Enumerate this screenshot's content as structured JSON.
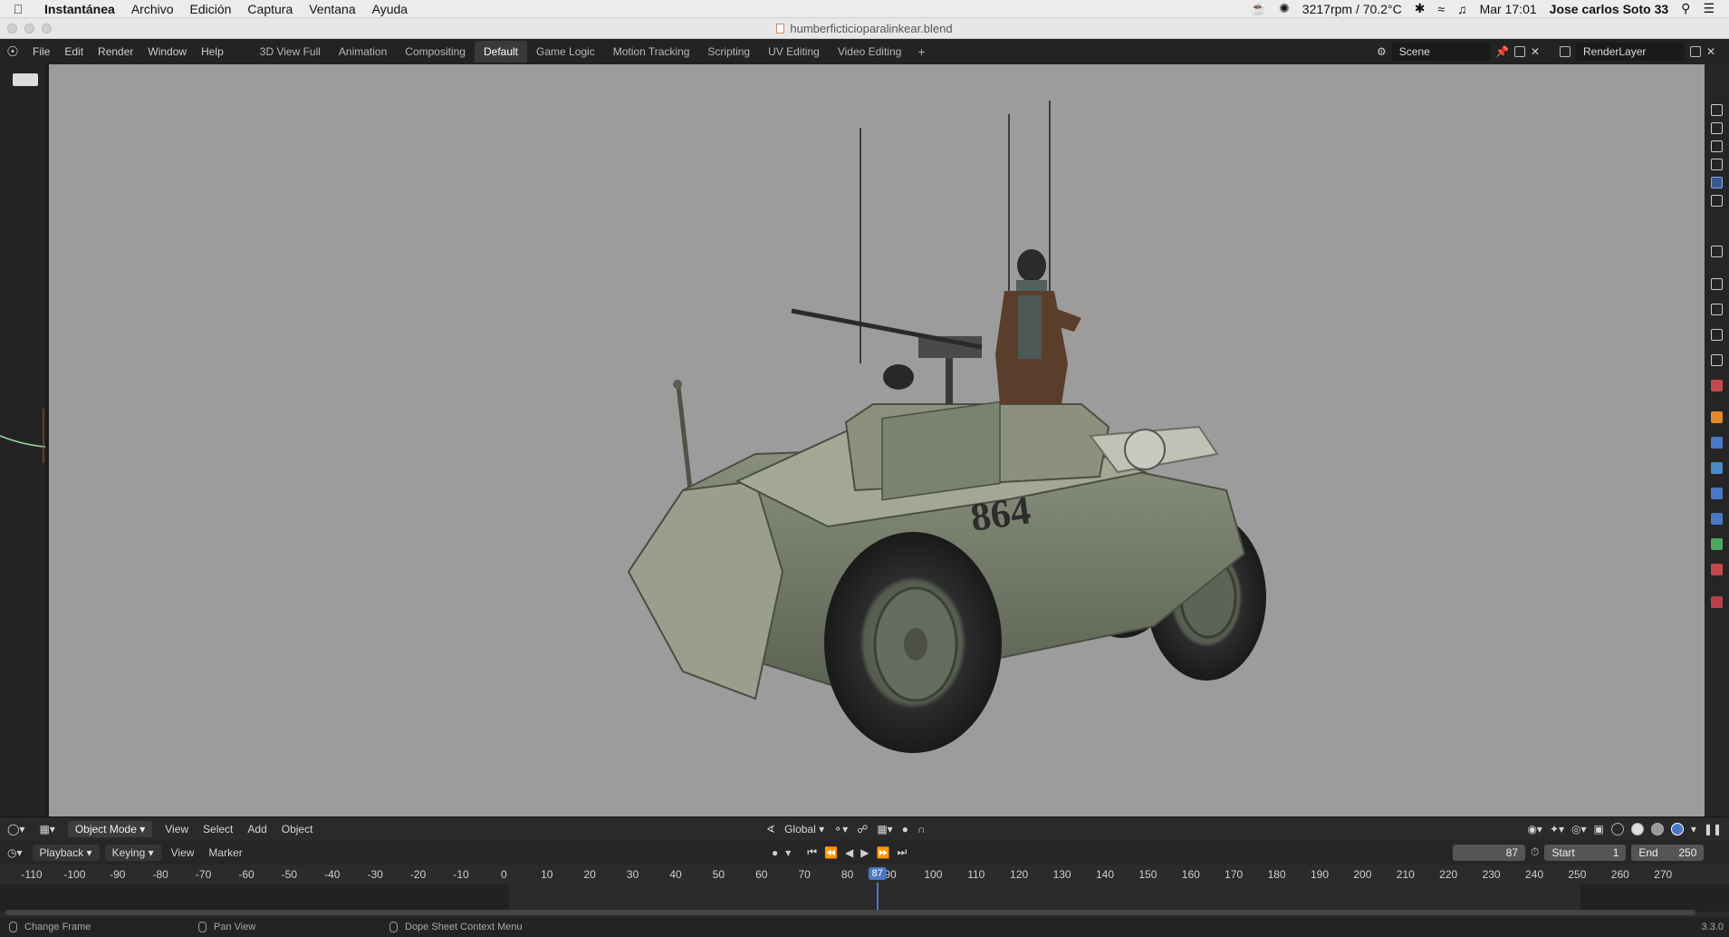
{
  "mac_menubar": {
    "app_name": "Instantánea",
    "menus": [
      "Archivo",
      "Edición",
      "Captura",
      "Ventana",
      "Ayuda"
    ],
    "status": {
      "fan": "3217rpm / 70.2°C",
      "clock": "Mar 17:01",
      "user": "Jose carlos Soto 33"
    }
  },
  "window": {
    "title": "humberficticioparalinkear.blend"
  },
  "topbar": {
    "menus": [
      "File",
      "Edit",
      "Render",
      "Window",
      "Help"
    ],
    "workspaces": [
      "3D View Full",
      "Animation",
      "Compositing",
      "Default",
      "Game Logic",
      "Motion Tracking",
      "Scripting",
      "UV Editing",
      "Video Editing"
    ],
    "active_workspace": "Default",
    "add_tab": "+",
    "scene": "Scene",
    "render_layer": "RenderLayer"
  },
  "viewport_header": {
    "mode": "Object Mode",
    "menus": [
      "View",
      "Select",
      "Add",
      "Object"
    ],
    "orientation": "Global"
  },
  "timeline_header": {
    "playback_label": "Playback",
    "keying_label": "Keying",
    "view_label": "View",
    "marker_label": "Marker",
    "current_frame": "87",
    "start_label": "Start",
    "start_value": "1",
    "end_label": "End",
    "end_value": "250"
  },
  "timeline": {
    "ticks": [
      "-110",
      "-100",
      "-90",
      "-80",
      "-70",
      "-60",
      "-50",
      "-40",
      "-30",
      "-20",
      "-10",
      "0",
      "10",
      "20",
      "30",
      "40",
      "50",
      "60",
      "70",
      "80",
      "90",
      "100",
      "110",
      "120",
      "130",
      "140",
      "150",
      "160",
      "170",
      "180",
      "190",
      "200",
      "210",
      "220",
      "230",
      "240",
      "250",
      "260",
      "270"
    ],
    "playhead": "87"
  },
  "statusbar": {
    "items": [
      "Change Frame",
      "Pan View",
      "Dope Sheet Context Menu"
    ],
    "version": "3.3.0"
  },
  "vehicle": {
    "number": "864"
  },
  "colors": {
    "viewport_bg": "#9c9c9c",
    "accent": "#4a78c6",
    "vehicle_body": "#7d8470"
  }
}
